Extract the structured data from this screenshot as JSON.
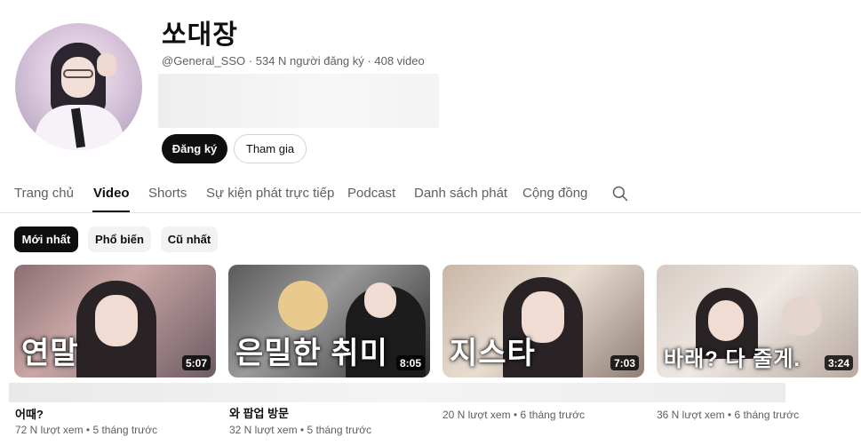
{
  "channel": {
    "name": "쏘대장",
    "handle": "@General_SSO",
    "subscribers": "534 N người đăng ký",
    "video_count": "408 video",
    "separator": "·"
  },
  "buttons": {
    "subscribe": "Đăng ký",
    "join": "Tham gia"
  },
  "tabs": [
    {
      "label": "Trang chủ"
    },
    {
      "label": "Video"
    },
    {
      "label": "Shorts"
    },
    {
      "label": "Sự kiện phát trực tiếp"
    },
    {
      "label": "Podcast"
    },
    {
      "label": "Danh sách phát"
    },
    {
      "label": "Cộng đồng"
    }
  ],
  "active_tab": "Video",
  "chips": [
    {
      "label": "Mới nhất"
    },
    {
      "label": "Phổ biến"
    },
    {
      "label": "Cũ nhất"
    }
  ],
  "videos": [
    {
      "thumb_text": "연말",
      "duration": "5:07",
      "title": "어때?",
      "views": "72 N lượt xem",
      "age": "5 tháng trước"
    },
    {
      "thumb_text": "은밀한 취미",
      "duration": "8:05",
      "title": "와 팝업 방문",
      "views": "32 N lượt xem",
      "age": "5 tháng trước"
    },
    {
      "thumb_text": "지스타",
      "duration": "7:03",
      "title": "",
      "views": "20 N lượt xem",
      "age": "6 tháng trước"
    },
    {
      "thumb_text": "바래? 다 줄게.",
      "duration": "3:24",
      "title": "",
      "views": "36 N lượt xem",
      "age": "6 tháng trước"
    }
  ],
  "colors": {
    "primary_text": "#0f0f0f",
    "secondary_text": "#606060",
    "chip_bg": "#f2f2f2",
    "subscribe_bg": "#0f0f0f"
  },
  "icons": {
    "search": "search-icon"
  }
}
